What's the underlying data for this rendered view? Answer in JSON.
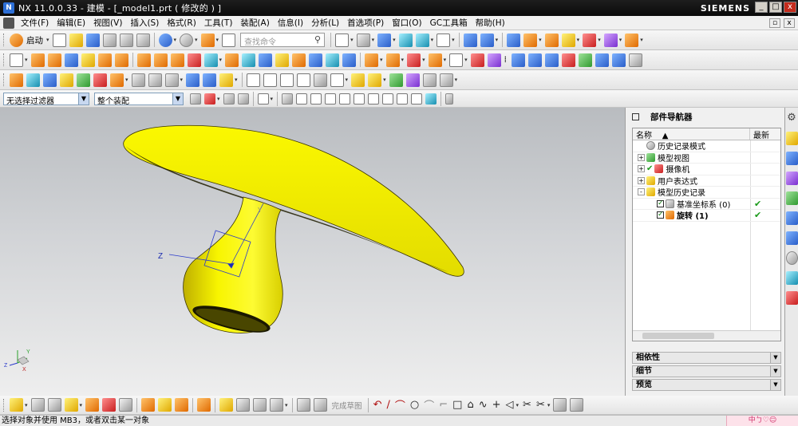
{
  "window": {
    "title": "NX 11.0.0.33 - 建模 - [_model1.prt  ( 修改的 ) ]",
    "brand": "SIEMENS",
    "buttons": [
      "_",
      "□",
      "x"
    ]
  },
  "menubar": {
    "items": [
      "文件(F)",
      "编辑(E)",
      "视图(V)",
      "插入(S)",
      "格式(R)",
      "工具(T)",
      "装配(A)",
      "信息(I)",
      "分析(L)",
      "首选项(P)",
      "窗口(O)",
      "GC工具箱",
      "帮助(H)"
    ]
  },
  "toolbar1": {
    "start_label": "启动",
    "command_search_placeholder": "查找命令"
  },
  "filterbar": {
    "selection_filter": "无选择过滤器",
    "scope": "整个装配"
  },
  "viewport": {
    "axis_label_z": "Z",
    "axis_label_y": "Y",
    "triad_x": "X",
    "triad_y": "Y",
    "triad_z": "Z",
    "model_color": "#f2f000"
  },
  "part_navigator": {
    "title": "部件导航器",
    "columns": [
      "名称",
      "最新"
    ],
    "rows": [
      {
        "label": "历史记录模式",
        "expander": "",
        "checked": false,
        "latest": ""
      },
      {
        "label": "模型视图",
        "expander": "+",
        "checked": false,
        "latest": ""
      },
      {
        "label": "摄像机",
        "expander": "+",
        "checked": true,
        "latest": ""
      },
      {
        "label": "用户表达式",
        "expander": "+",
        "checked": false,
        "latest": ""
      },
      {
        "label": "模型历史记录",
        "expander": "-",
        "checked": false,
        "latest": ""
      },
      {
        "label": "基准坐标系 (0)",
        "expander": "",
        "checked": true,
        "latest": "✔"
      },
      {
        "label": "旋转 (1)",
        "expander": "",
        "checked": true,
        "latest": "✔"
      }
    ],
    "sections": [
      "相依性",
      "细节",
      "预览"
    ]
  },
  "bottom_toolbar": {
    "finish_sketch": "完成草图"
  },
  "status": {
    "prompt": "选择对象并使用 MB3，或者双击某一对象",
    "ime_text": "中ㄅ♡☺"
  }
}
